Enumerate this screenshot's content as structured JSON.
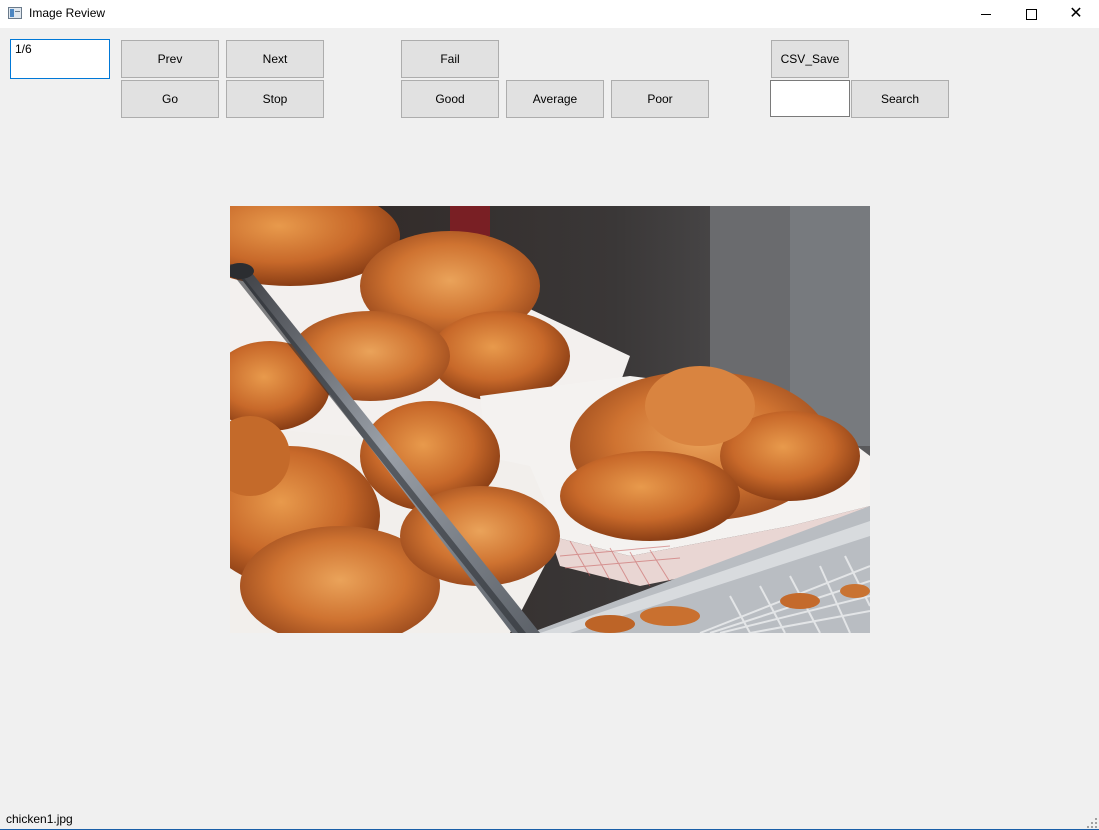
{
  "window": {
    "title": "Image Review",
    "icons": [
      "app-icon",
      "minimize-icon",
      "maximize-icon",
      "close-icon"
    ]
  },
  "toolbar": {
    "index_value": "1/6",
    "prev_label": "Prev",
    "next_label": "Next",
    "go_label": "Go",
    "stop_label": "Stop",
    "fail_label": "Fail",
    "good_label": "Good",
    "average_label": "Average",
    "poor_label": "Poor",
    "csv_save_label": "CSV_Save",
    "search_value": "",
    "search_label": "Search"
  },
  "image": {
    "subject": "fried chicken in paper trays with metal tongs"
  },
  "status": {
    "filename": "chicken1.jpg"
  },
  "colors": {
    "focus_border": "#0078d7",
    "button_face": "#e1e1e1",
    "window_bg": "#f0f0f0"
  }
}
